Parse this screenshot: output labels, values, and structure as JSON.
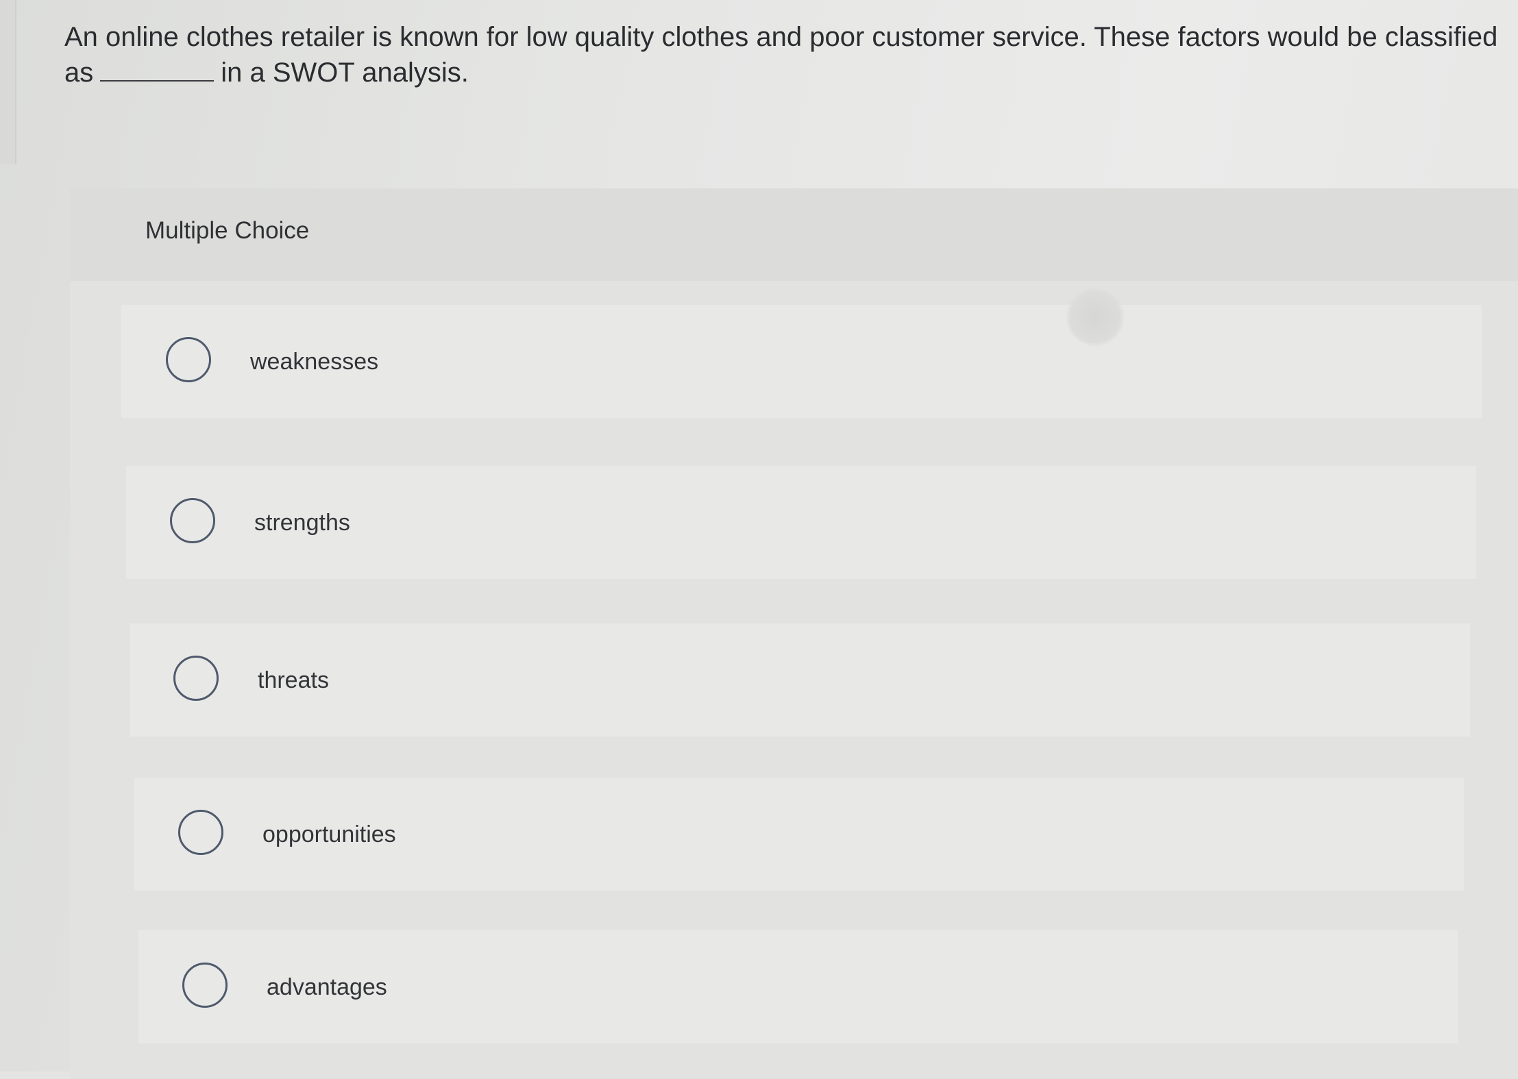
{
  "question": {
    "line1": "An online clothes retailer is known for low quality clothes and poor customer service. These factors would be classified",
    "line2_prefix": "as",
    "line2_suffix": "in a SWOT analysis."
  },
  "multiple_choice": {
    "title": "Multiple Choice",
    "options": [
      {
        "label": "weaknesses"
      },
      {
        "label": "strengths"
      },
      {
        "label": "threats"
      },
      {
        "label": "opportunities"
      },
      {
        "label": "advantages"
      }
    ]
  }
}
